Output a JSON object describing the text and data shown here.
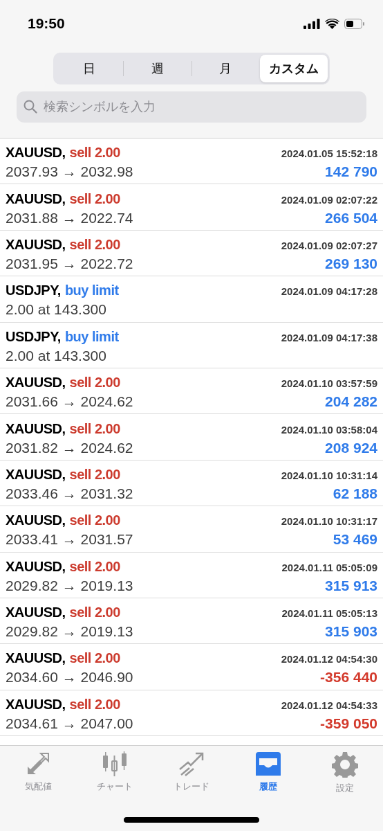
{
  "status_bar": {
    "time": "19:50"
  },
  "segments": [
    {
      "label": "日",
      "selected": false
    },
    {
      "label": "週",
      "selected": false
    },
    {
      "label": "月",
      "selected": false
    },
    {
      "label": "カスタム",
      "selected": true
    }
  ],
  "search": {
    "placeholder": "検索シンボルを入力"
  },
  "rows": [
    {
      "symbol": "XAUUSD,",
      "order": "sell 2.00",
      "kind": "sell",
      "time": "2024.01.05 15:52:18",
      "prices": "2037.93 → 2032.98",
      "profit": "142 790",
      "color": "#2f7bea"
    },
    {
      "symbol": "XAUUSD,",
      "order": "sell 2.00",
      "kind": "sell",
      "time": "2024.01.09 02:07:22",
      "prices": "2031.88 → 2022.74",
      "profit": "266 504",
      "color": "#2f7bea"
    },
    {
      "symbol": "XAUUSD,",
      "order": "sell 2.00",
      "kind": "sell",
      "time": "2024.01.09 02:07:27",
      "prices": "2031.95 → 2022.72",
      "profit": "269 130",
      "color": "#2f7bea"
    },
    {
      "symbol": "USDJPY,",
      "order": "buy limit",
      "kind": "buy",
      "time": "2024.01.09 04:17:28",
      "prices": "2.00 at 143.300"
    },
    {
      "symbol": "USDJPY,",
      "order": "buy limit",
      "kind": "buy",
      "time": "2024.01.09 04:17:38",
      "prices": "2.00 at 143.300"
    },
    {
      "symbol": "XAUUSD,",
      "order": "sell 2.00",
      "kind": "sell",
      "time": "2024.01.10 03:57:59",
      "prices": "2031.66 → 2024.62",
      "profit": "204 282",
      "color": "#2f7bea"
    },
    {
      "symbol": "XAUUSD,",
      "order": "sell 2.00",
      "kind": "sell",
      "time": "2024.01.10 03:58:04",
      "prices": "2031.82 → 2024.62",
      "profit": "208 924",
      "color": "#2f7bea"
    },
    {
      "symbol": "XAUUSD,",
      "order": "sell 2.00",
      "kind": "sell",
      "time": "2024.01.10 10:31:14",
      "prices": "2033.46 → 2031.32",
      "profit": "62 188",
      "color": "#2f7bea"
    },
    {
      "symbol": "XAUUSD,",
      "order": "sell 2.00",
      "kind": "sell",
      "time": "2024.01.10 10:31:17",
      "prices": "2033.41 → 2031.57",
      "profit": "53 469",
      "color": "#2f7bea"
    },
    {
      "symbol": "XAUUSD,",
      "order": "sell 2.00",
      "kind": "sell",
      "time": "2024.01.11 05:05:09",
      "prices": "2029.82 → 2019.13",
      "profit": "315 913",
      "color": "#2f7bea"
    },
    {
      "symbol": "XAUUSD,",
      "order": "sell 2.00",
      "kind": "sell",
      "time": "2024.01.11 05:05:13",
      "prices": "2029.82 → 2019.13",
      "profit": "315 903",
      "color": "#2f7bea"
    },
    {
      "symbol": "XAUUSD,",
      "order": "sell 2.00",
      "kind": "sell",
      "time": "2024.01.12 04:54:30",
      "prices": "2034.60 → 2046.90",
      "profit": "-356 440",
      "color": "#d33a2c"
    },
    {
      "symbol": "XAUUSD,",
      "order": "sell 2.00",
      "kind": "sell",
      "time": "2024.01.12 04:54:33",
      "prices": "2034.61 → 2047.00",
      "profit": "-359 050",
      "color": "#d33a2c"
    }
  ],
  "tab_bar": [
    {
      "label": "気配値",
      "selected": false
    },
    {
      "label": "チャート",
      "selected": false
    },
    {
      "label": "トレード",
      "selected": false
    },
    {
      "label": "履歴",
      "selected": true
    },
    {
      "label": "設定",
      "selected": false
    }
  ]
}
